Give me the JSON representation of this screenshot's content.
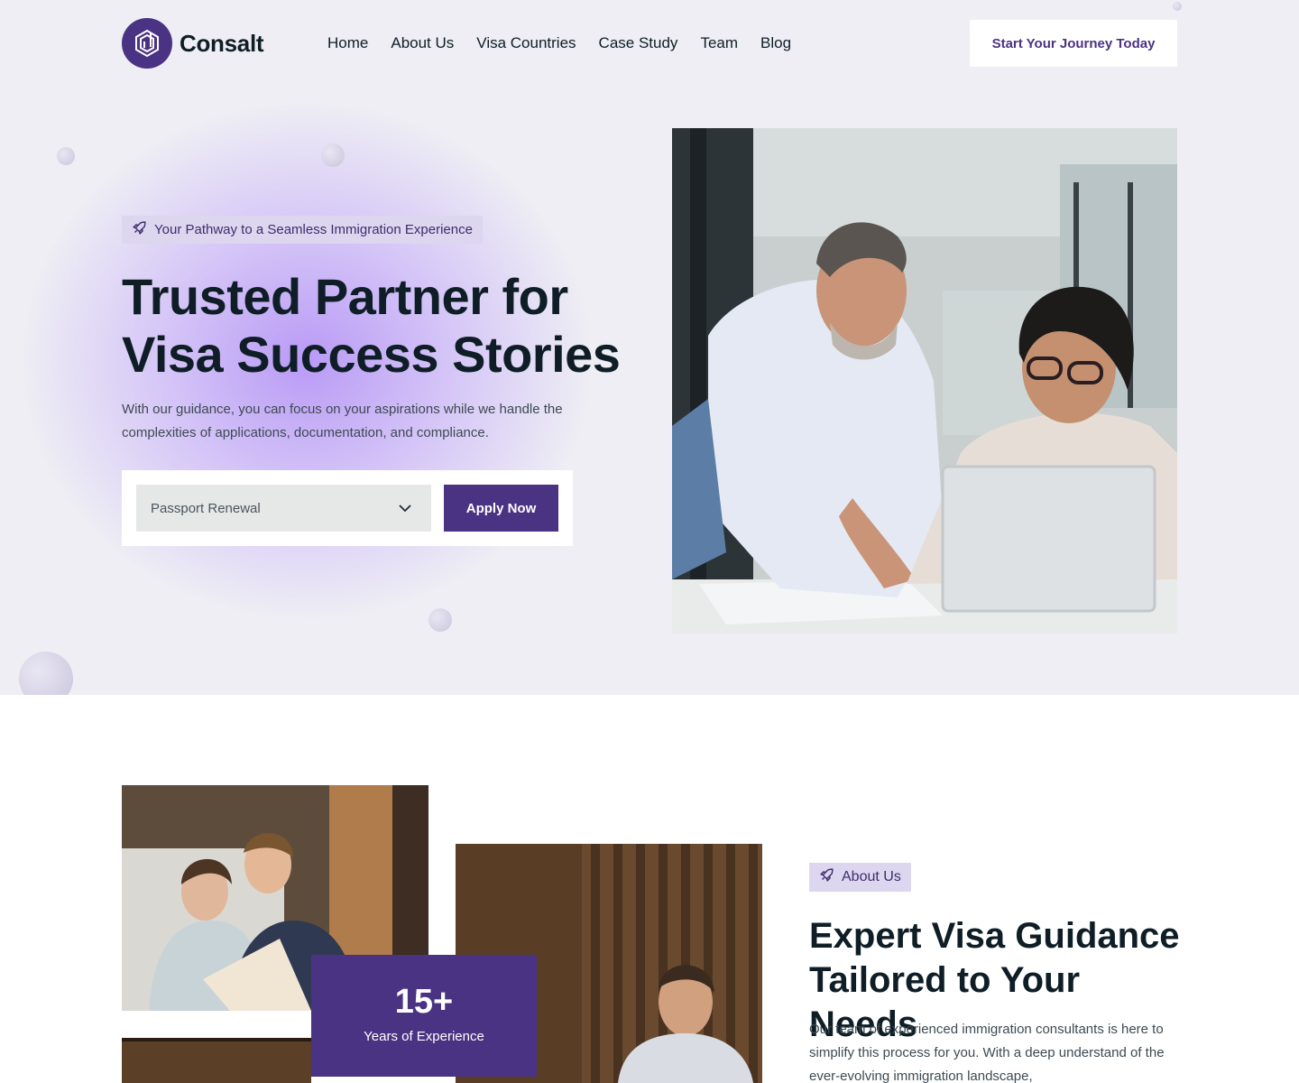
{
  "brand": {
    "name": "Consalt",
    "accent": "#4a3382"
  },
  "nav": {
    "items": [
      "Home",
      "About Us",
      "Visa Countries",
      "Case Study",
      "Team",
      "Blog"
    ],
    "cta": "Start Your Journey Today"
  },
  "hero": {
    "badge": "Your Pathway to a Seamless Immigration Experience",
    "title_line1": "Trusted Partner for",
    "title_line2": "Visa Success Stories",
    "description": "With our guidance, you can focus on your aspirations while we handle the complexities of applications, documentation, and compliance.",
    "select_value": "Passport Renewal",
    "apply_label": "Apply Now"
  },
  "about": {
    "badge": "About Us",
    "title_line1": "Expert Visa Guidance",
    "title_line2": "Tailored to Your Needs",
    "description": "Our team of experienced immigration consultants is here to simplify this process for you. With a deep understand of the ever-evolving immigration landscape,",
    "stat_number": "15+",
    "stat_label": "Years of Experience"
  }
}
